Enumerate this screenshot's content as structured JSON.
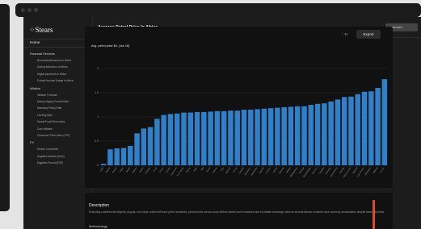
{
  "app": {
    "logo": "Stears",
    "page_title": "Average Petrol Price In Africa",
    "account_label": "Account"
  },
  "sidebar": {
    "home": "Home",
    "sections": [
      {
        "label": "Financial Services",
        "items": [
          "Borrowing Behaviour In Africa",
          "Saving Behaviour In Africa",
          "Digital payments In Africa",
          "Formal Account Usage In Africa"
        ]
      },
      {
        "label": "Inflation",
        "items": [
          "Inflation Forecast",
          "Money Supply Growth Rate",
          "Monetary Policy Rate",
          "Lending Rate",
          "Global Food Price Index",
          "Core Inflation",
          "Consumer Price Index (CPI)"
        ]
      },
      {
        "label": "FX",
        "items": [
          "African Currencies",
          "Angolan Kwanza (AOA)",
          "Egyptian Pound (EGP)"
        ]
      }
    ]
  },
  "toolbar": {
    "export_label": "Export",
    "view_icons": [
      "chart-icon",
      "table-icon"
    ]
  },
  "chart_data": {
    "type": "bar",
    "title": "Avg. petrol price $/L (Jan 18)",
    "ylim": [
      0,
      2
    ],
    "yticks": [
      "0",
      "0.5",
      "1",
      "1.5",
      "2"
    ],
    "grid": true,
    "bar_color": "#2f80c8",
    "categories": [
      "Libya",
      "Algeria",
      "Angola",
      "Egypt",
      "Sudan",
      "Nigeria",
      "Gabon",
      "Ethiopia",
      "Chad",
      "Congo",
      "Tunisia",
      "Cameroon",
      "Eq. Guinea",
      "Ghana",
      "Niger",
      "Mali",
      "Benin",
      "Guinea",
      "Togo",
      "Burkina",
      "Kenya",
      "Gambia",
      "Botswana",
      "Mauritania",
      "Uganda",
      "Lesotho",
      "Liberia",
      "Rwanda",
      "Malawi",
      "Madagascar",
      "Senegal",
      "Mozambique",
      "Morocco",
      "Namibia",
      "Tanzania",
      "South Africa",
      "Zambia",
      "Sierra Leone",
      "Burundi",
      "Cote d'Ivoire",
      "Zimbabwe",
      "Djibouti",
      "C.A.R."
    ],
    "values": [
      0.03,
      0.33,
      0.35,
      0.36,
      0.4,
      0.66,
      0.76,
      0.79,
      0.96,
      1.04,
      1.06,
      1.07,
      1.09,
      1.09,
      1.1,
      1.1,
      1.11,
      1.12,
      1.12,
      1.13,
      1.13,
      1.15,
      1.15,
      1.16,
      1.17,
      1.18,
      1.19,
      1.2,
      1.21,
      1.22,
      1.22,
      1.25,
      1.27,
      1.28,
      1.32,
      1.36,
      1.41,
      1.42,
      1.47,
      1.52,
      1.53,
      1.6,
      1.78
    ]
  },
  "description": {
    "title": "Description",
    "text": "Excluding countries like Algeria, Angola, and Libya, which still have petrol subsidies, petrol prices across some African states have increased due to volatile exchange rates as several African countries face currency devaluations despite lower oil prices.",
    "more": "Methodology"
  }
}
